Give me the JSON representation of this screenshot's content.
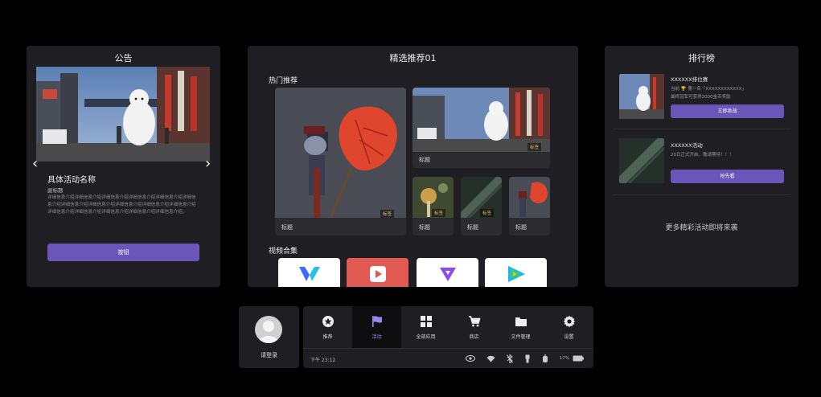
{
  "notice": {
    "title": "公告",
    "event_name": "具体活动名称",
    "event_subtitle": "副标题",
    "event_detail": "详细信息介绍详细信息介绍详细信息介绍详细信息介绍详细信息介绍详细信息介绍详细信息介绍详细信息介绍详细信息介绍详细信息介绍详细信息介绍详细信息介绍详细信息介绍详细信息介绍详细信息介绍详细信息介绍。",
    "button_label": "按钮"
  },
  "featured": {
    "title": "精选推荐01",
    "hot_section": "热门推荐",
    "cards": [
      {
        "title": "标题",
        "tag": "标签"
      },
      {
        "title": "标题",
        "tag": "标签"
      },
      {
        "title": "标题",
        "tag": "标签"
      },
      {
        "title": "标题",
        "tag": "标签"
      },
      {
        "title": "标题",
        "tag": ""
      }
    ],
    "video_section": "视频合集",
    "apps": [
      {
        "icon": "v-logo-icon",
        "color": "#ffffff"
      },
      {
        "icon": "play-icon",
        "color": "#e05a52"
      },
      {
        "icon": "triangle-play-icon",
        "color": "#ffffff"
      },
      {
        "icon": "tencent-video-icon",
        "color": "#ffffff"
      }
    ]
  },
  "ranking": {
    "title": "排行榜",
    "items": [
      {
        "name": "XXXXXX排位赛",
        "line1": "当前 🏆 第一名「XXXXXXXXXXXX」",
        "line2": "最终冠军可获得2000金币奖励",
        "button": "立即挑战"
      },
      {
        "name": "XXXXXX活动",
        "line1": "20日正式开启，敬请期待！！！",
        "line2": "",
        "button": "抢先看"
      }
    ],
    "more_text": "更多精彩活动即将来袭"
  },
  "login": {
    "label": "请登录"
  },
  "dock": {
    "tabs": [
      {
        "label": "推荐",
        "icon": "star-badge-icon",
        "active": false
      },
      {
        "label": "活动",
        "icon": "flag-icon",
        "active": true
      },
      {
        "label": "全部应用",
        "icon": "grid-icon",
        "active": false
      },
      {
        "label": "商店",
        "icon": "cart-icon",
        "active": false
      },
      {
        "label": "文件管理",
        "icon": "folder-icon",
        "active": false
      },
      {
        "label": "设置",
        "icon": "gear-icon",
        "active": false
      }
    ],
    "status": {
      "time": "下午 23:12",
      "battery": "17%"
    }
  },
  "colors": {
    "accent": "#6a55b8",
    "active_label": "#9a86f0",
    "panel": "#1f1f23",
    "tag": "#e8b460"
  }
}
